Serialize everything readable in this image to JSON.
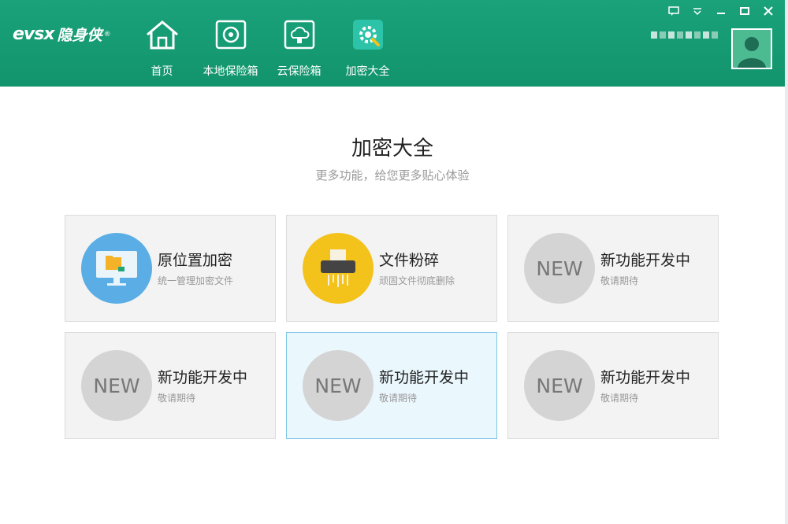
{
  "app": {
    "logo_mark": "evsx",
    "logo_name": "隐身侠",
    "logo_reg": "®"
  },
  "nav": [
    {
      "label": "首页",
      "icon": "home-icon"
    },
    {
      "label": "本地保险箱",
      "icon": "safe-icon"
    },
    {
      "label": "云保险箱",
      "icon": "cloud-safe-icon"
    },
    {
      "label": "加密大全",
      "icon": "gear-wrench-icon"
    }
  ],
  "window_controls": [
    "feedback-icon",
    "dropdown-icon",
    "minimize-icon",
    "maximize-icon",
    "close-icon"
  ],
  "page": {
    "title": "加密大全",
    "subtitle": "更多功能，给您更多贴心体验"
  },
  "cards": [
    {
      "title": "原位置加密",
      "desc": "统一管理加密文件",
      "icon": "monitor-folder-icon"
    },
    {
      "title": "文件粉碎",
      "desc": "顽固文件彻底删除",
      "icon": "shredder-icon"
    },
    {
      "title": "新功能开发中",
      "desc": "敬请期待",
      "badge": "NEW"
    },
    {
      "title": "新功能开发中",
      "desc": "敬请期待",
      "badge": "NEW"
    },
    {
      "title": "新功能开发中",
      "desc": "敬请期待",
      "badge": "NEW"
    },
    {
      "title": "新功能开发中",
      "desc": "敬请期待",
      "badge": "NEW"
    }
  ],
  "colors": {
    "header": "#12946c",
    "accent_blue": "#5aaee5",
    "accent_yellow": "#f3c21b",
    "active_border": "#7fc6e6"
  }
}
